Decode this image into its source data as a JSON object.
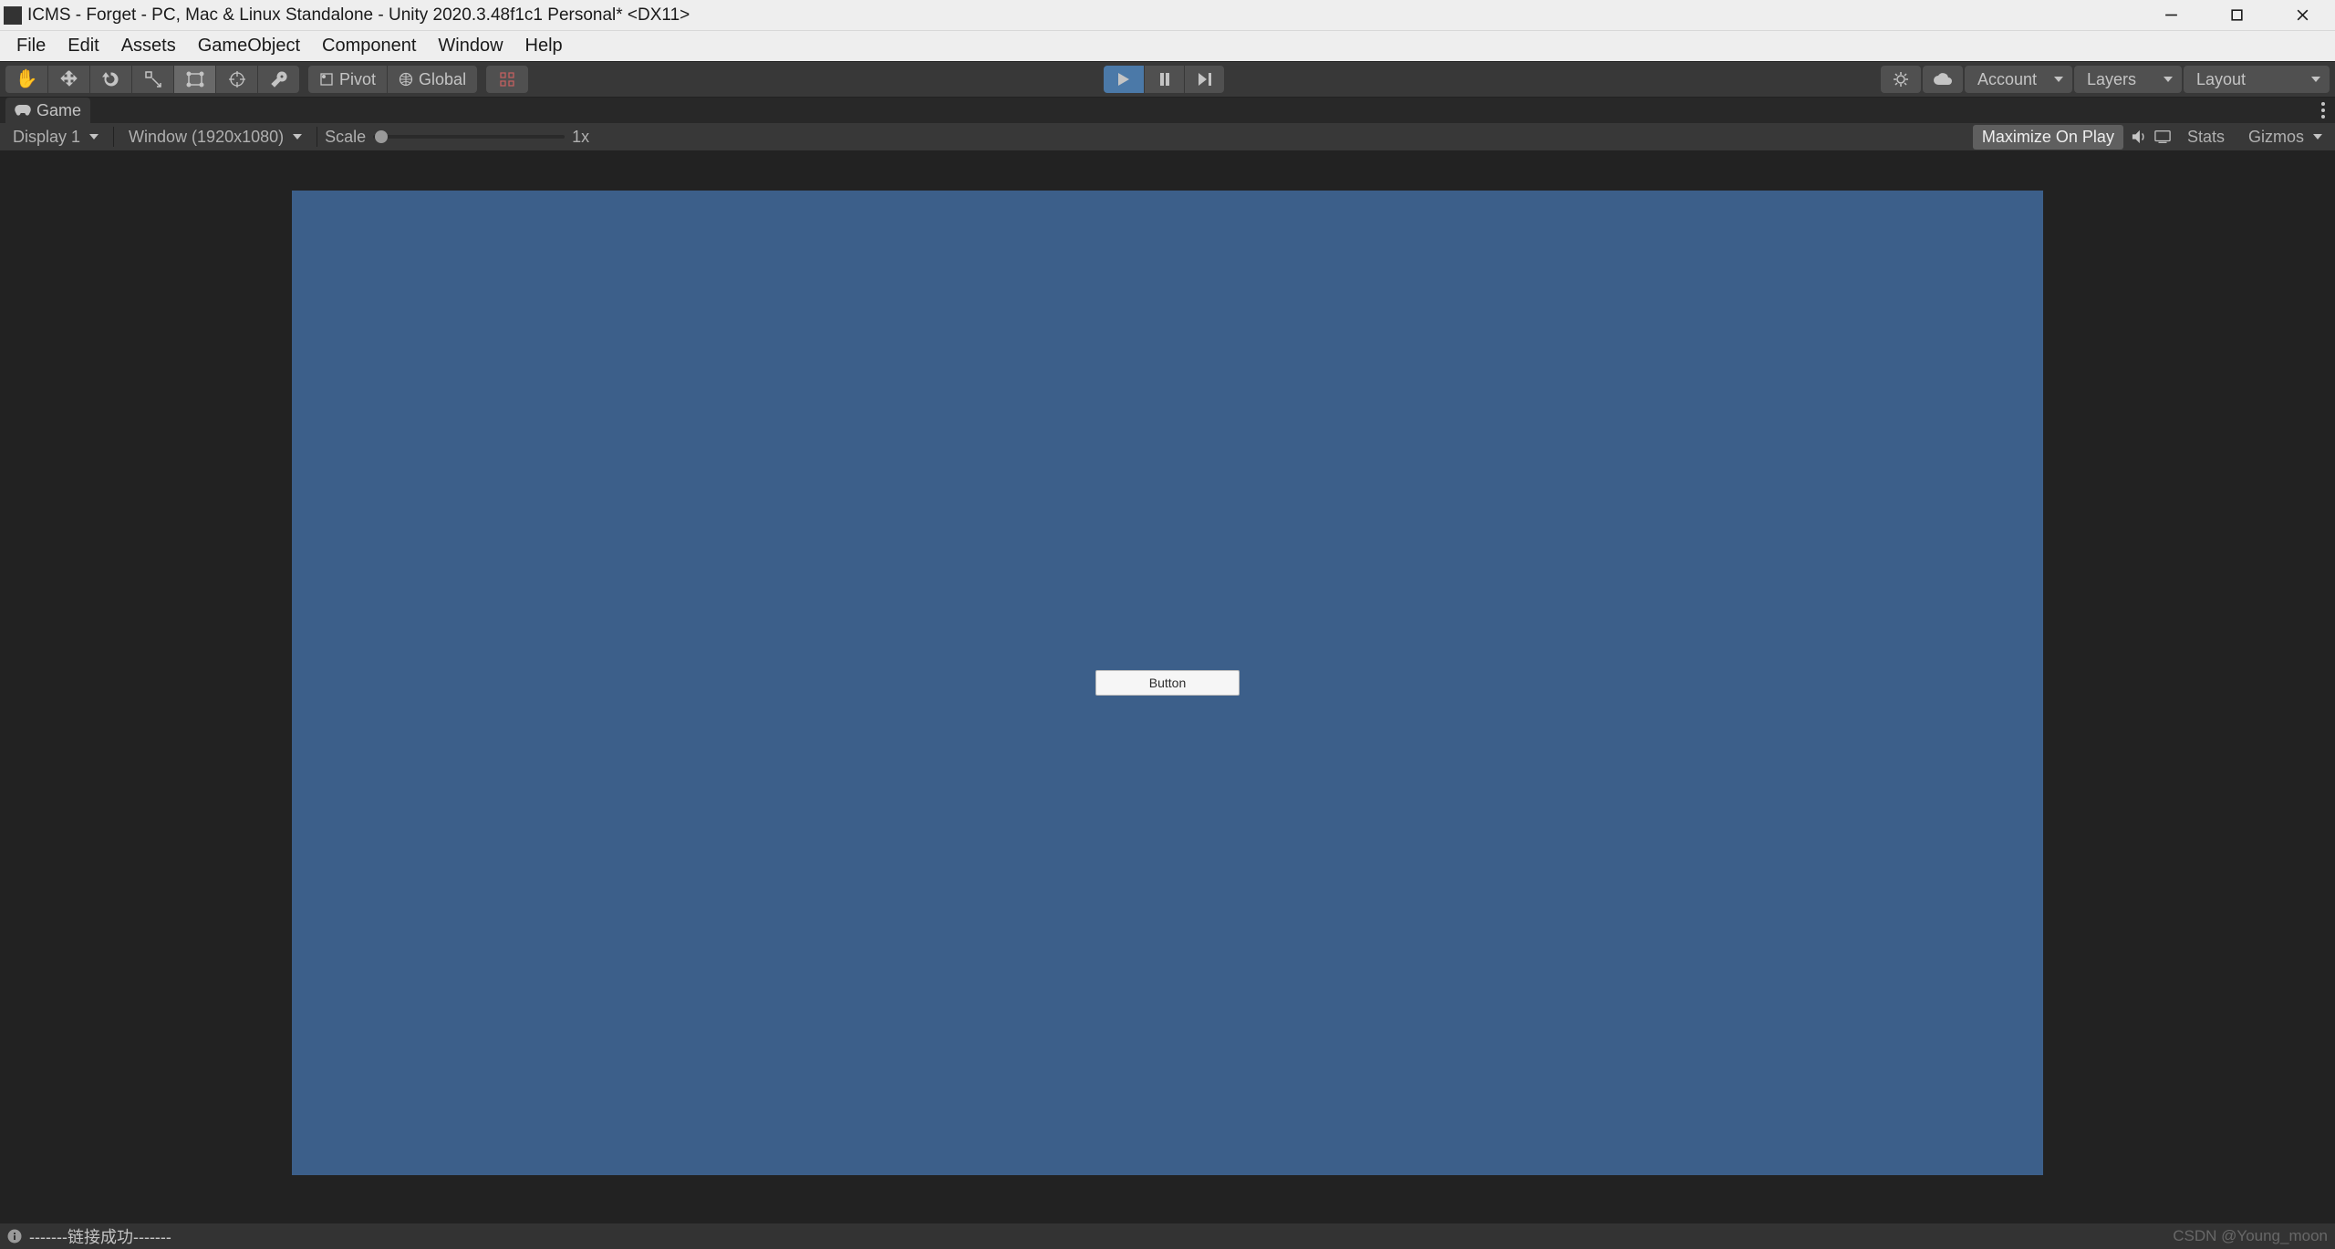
{
  "window_title": "ICMS - Forget - PC, Mac & Linux Standalone - Unity 2020.3.48f1c1 Personal* <DX11>",
  "menubar": {
    "items": [
      "File",
      "Edit",
      "Assets",
      "GameObject",
      "Component",
      "Window",
      "Help"
    ]
  },
  "toolbar": {
    "pivot_label": "Pivot",
    "global_label": "Global",
    "account_label": "Account",
    "layers_label": "Layers",
    "layout_label": "Layout"
  },
  "tabs": {
    "game": "Game"
  },
  "gameview": {
    "display_label": "Display 1",
    "aspect_label": "Window (1920x1080)",
    "scale_label": "Scale",
    "scale_value": "1x",
    "max_on_play": "Maximize On Play",
    "stats_label": "Stats",
    "gizmos_label": "Gizmos"
  },
  "scene": {
    "button_label": "Button"
  },
  "statusbar": {
    "message": "-------链接成功-------",
    "watermark": "CSDN @Young_moon"
  }
}
